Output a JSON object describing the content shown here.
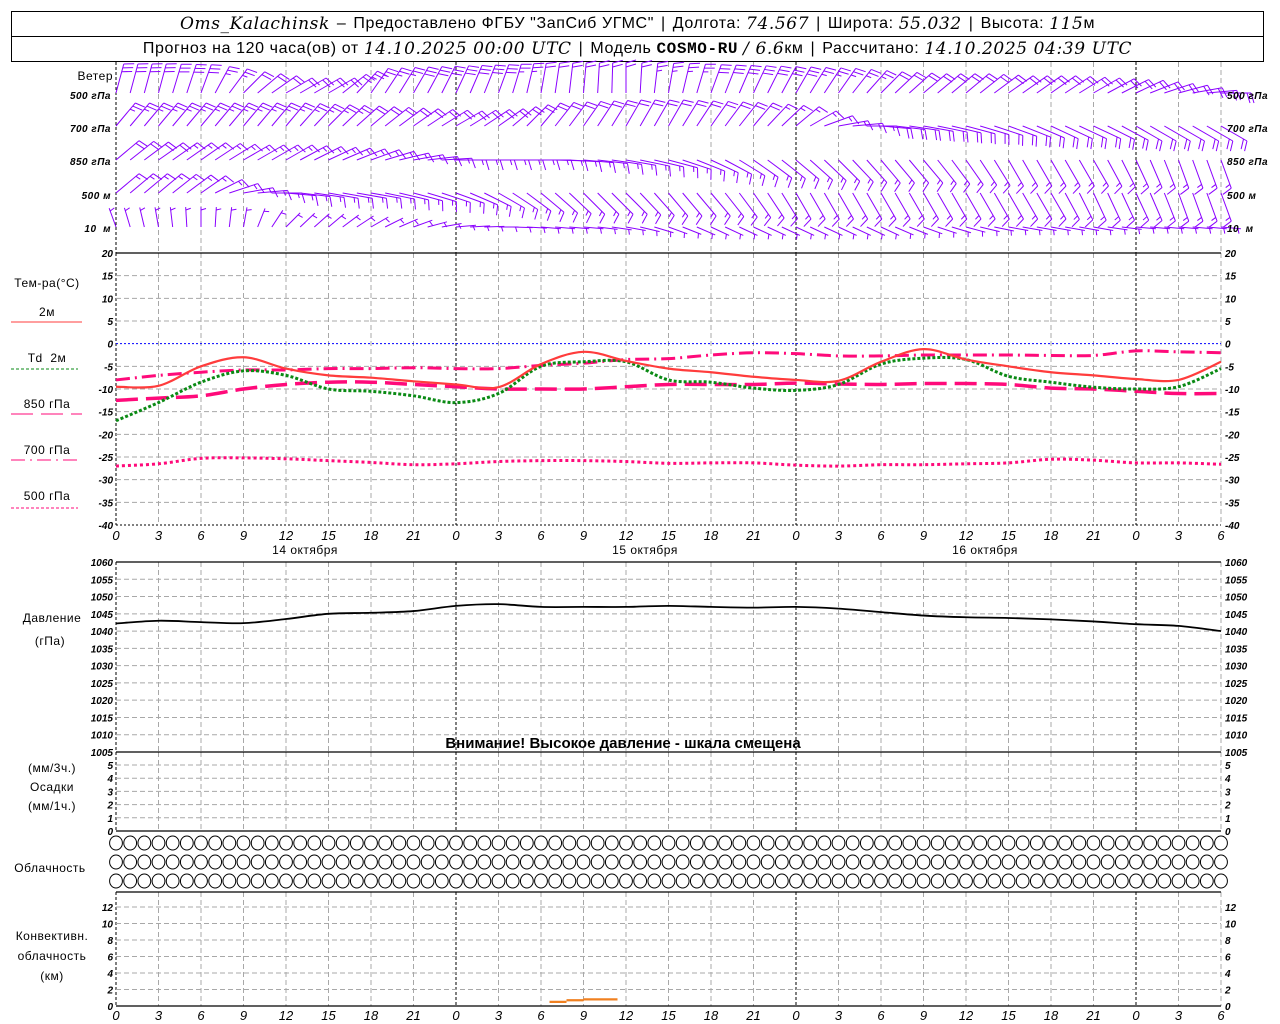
{
  "header": {
    "station": "Oms_Kalachinsk",
    "dash": "–",
    "provider": "Предоставлено ФГБУ \"ЗапСиб УГМС\"",
    "lon_label": "Долгота:",
    "lon": "74.567",
    "lat_label": "Широта:",
    "lat": "55.032",
    "alt_label": "Высота:",
    "alt": "115",
    "alt_unit": "м",
    "forecast_label": "Прогноз на 120 часа(ов) от",
    "forecast_start": "14.10.2025 00:00 UTC",
    "model_label": "Модель",
    "model": "COSMO-RU",
    "resolution": "/ 6.6",
    "resolution_unit": "км",
    "computed_label": "Рассчитано:",
    "computed": "14.10.2025 04:39 UTC"
  },
  "labels": {
    "wind": "Ветер",
    "wind_levels": [
      "500 гПа",
      "700 гПа",
      "850 гПа",
      "500 м",
      "10  м"
    ],
    "temp_title": "Тем-ра(°C)",
    "legend_2m": "2м",
    "legend_td": "Td  2м",
    "legend_850": "850 гПа",
    "legend_700": "700 гПа",
    "legend_500": "500 гПа",
    "pressure_1": "Давление",
    "pressure_2": "(гПа)",
    "precip_1": "(мм/3ч.)",
    "precip_2": "Осадки",
    "precip_3": "(мм/1ч.)",
    "cloud": "Облачность",
    "conv_1": "Конвективн.",
    "conv_2": "облачность",
    "conv_3": "(км)",
    "warning": "Внимание! Высокое давление - шкала смещена",
    "days": [
      "14 октября",
      "15 октября",
      "16 октября"
    ]
  },
  "colors": {
    "t2m": "#ff3c3c",
    "td2m": "#0a8a14",
    "t850": "#ff0a7a",
    "t700": "#ff0a7a",
    "t500": "#ff0a7a",
    "wind": "#8a00ff",
    "pressure": "#000000",
    "conv": "#f08020",
    "zero_line": "#0000ff",
    "grid": "#a8a8a8"
  },
  "chart_data": {
    "type": "line",
    "x_step_hours": 3,
    "x": [
      0,
      3,
      6,
      9,
      12,
      15,
      18,
      21,
      0,
      3,
      6,
      9,
      12,
      15,
      18,
      21,
      0,
      3,
      6,
      9,
      12,
      15,
      18,
      21,
      0,
      3,
      6
    ],
    "temperature": {
      "ylabel": "Тем-ра(°C)",
      "ylim": [
        -40,
        20
      ],
      "yticks": [
        20,
        15,
        10,
        5,
        0,
        -5,
        -10,
        -15,
        -20,
        -25,
        -30,
        -35,
        -40
      ],
      "grid": true,
      "series": [
        {
          "name": "2м",
          "key": "t2m",
          "values": [
            -9.5,
            -9.3,
            -5,
            -3,
            -5.5,
            -7,
            -7.5,
            -8.3,
            -9,
            -9.6,
            -4.5,
            -1.8,
            -3.8,
            -5.5,
            -6.3,
            -7.3,
            -8,
            -8.2,
            -4,
            -1.2,
            -3.5,
            -5,
            -6.3,
            -7,
            -7.8,
            -8,
            -4
          ]
        },
        {
          "name": "Td  2м",
          "key": "td2m",
          "values": [
            -17,
            -13,
            -8.5,
            -6,
            -7,
            -10,
            -10.5,
            -11.5,
            -13,
            -11,
            -5,
            -4,
            -4,
            -8,
            -8.5,
            -9.8,
            -10.3,
            -9,
            -4.5,
            -3.2,
            -3.5,
            -7.2,
            -8.5,
            -9.6,
            -10,
            -9.5,
            -5.5
          ]
        },
        {
          "name": "850 гПа",
          "key": "t850",
          "values": [
            -12.5,
            -12,
            -11.5,
            -10,
            -9,
            -8.5,
            -8.5,
            -9,
            -9.5,
            -10,
            -10,
            -10,
            -9.5,
            -9,
            -9,
            -9,
            -8.7,
            -8.9,
            -9,
            -8.8,
            -8.8,
            -9,
            -9.8,
            -10,
            -10.5,
            -11,
            -11
          ]
        },
        {
          "name": "700 гПа",
          "key": "t700",
          "values": [
            -8,
            -7,
            -6.3,
            -5.8,
            -5.8,
            -5.5,
            -5.5,
            -5.3,
            -5.5,
            -5.5,
            -4.8,
            -4.3,
            -3.5,
            -3.3,
            -2.5,
            -2,
            -2.2,
            -2.7,
            -2.7,
            -2.5,
            -2.5,
            -2.5,
            -2.6,
            -2.6,
            -1.6,
            -1.8,
            -2
          ]
        },
        {
          "name": "500 гПа",
          "key": "t500",
          "values": [
            -27,
            -26.5,
            -25.3,
            -25.2,
            -25.4,
            -25.8,
            -26.2,
            -26.7,
            -26.5,
            -26,
            -25.8,
            -25.8,
            -26,
            -26.4,
            -26.3,
            -26.3,
            -26.8,
            -27,
            -26.7,
            -26.7,
            -26.5,
            -26.3,
            -25.5,
            -25.7,
            -26.3,
            -26.3,
            -26.6
          ]
        }
      ]
    },
    "pressure": {
      "ylabel": "Давление (гПа)",
      "ylim": [
        1005,
        1060
      ],
      "yticks": [
        1060,
        1055,
        1050,
        1045,
        1040,
        1035,
        1030,
        1025,
        1020,
        1015,
        1010,
        1005
      ],
      "values": [
        1042.2,
        1043,
        1042.6,
        1042.3,
        1043.5,
        1045,
        1045.3,
        1045.8,
        1047.3,
        1047.8,
        1047,
        1047,
        1047,
        1047.3,
        1047,
        1046.8,
        1047,
        1046.5,
        1045.5,
        1044.5,
        1044,
        1043.8,
        1043.4,
        1042.8,
        1042,
        1041.5,
        1040
      ]
    },
    "precipitation": {
      "ylim": [
        0,
        5
      ],
      "yticks": [
        5,
        4,
        3,
        2,
        1,
        0
      ],
      "values": [
        0,
        0,
        0,
        0,
        0,
        0,
        0,
        0,
        0,
        0,
        0,
        0,
        0,
        0,
        0,
        0,
        0,
        0,
        0,
        0,
        0,
        0,
        0,
        0,
        0,
        0,
        0
      ]
    },
    "cloudiness": {
      "rows": 3,
      "hourly_count": 79,
      "cover": "clear"
    },
    "convective_cloud": {
      "ylabel": "Конвективн. облачность (км)",
      "ylim": [
        0,
        14
      ],
      "yticks": [
        12,
        10,
        8,
        6,
        4,
        2,
        0
      ],
      "segments": [
        {
          "from_hour": 30.6,
          "to_hour": 31.8,
          "top_km": 0.5
        },
        {
          "from_hour": 31.8,
          "to_hour": 33.0,
          "top_km": 0.7
        },
        {
          "from_hour": 33.0,
          "to_hour": 35.4,
          "top_km": 0.8
        }
      ]
    },
    "wind": {
      "units": "m/s",
      "levels": [
        {
          "name": "500 гПа",
          "dir": [
            15,
            15,
            20,
            45,
            60,
            60,
            35,
            30,
            25,
            20,
            10,
            5,
            0,
            10,
            20,
            25,
            30,
            35,
            45,
            50,
            50,
            55,
            55,
            60,
            65,
            75,
            90
          ],
          "speed": [
            17,
            16,
            15,
            12,
            10,
            10,
            14,
            15,
            15,
            15,
            12,
            11,
            10,
            14,
            15,
            15,
            15,
            14,
            12,
            12,
            12,
            12,
            11,
            11,
            10,
            10,
            10
          ]
        },
        {
          "name": "700 гПа",
          "dir": [
            40,
            40,
            40,
            40,
            40,
            45,
            50,
            55,
            60,
            55,
            40,
            35,
            30,
            30,
            35,
            40,
            50,
            80,
            95,
            100,
            105,
            110,
            115,
            115,
            120,
            120,
            120
          ],
          "speed": [
            14,
            14,
            14,
            14,
            14,
            13,
            12,
            11,
            10,
            10,
            10,
            11,
            11,
            11,
            11,
            10,
            9,
            9,
            10,
            11,
            11,
            11,
            11,
            11,
            10,
            10,
            10
          ]
        },
        {
          "name": "850 гПа",
          "dir": [
            50,
            55,
            55,
            60,
            60,
            65,
            70,
            80,
            90,
            90,
            90,
            95,
            100,
            105,
            115,
            125,
            130,
            135,
            140,
            140,
            145,
            150,
            150,
            150,
            155,
            160,
            160
          ],
          "speed": [
            10,
            10,
            9,
            9,
            9,
            9,
            8,
            8,
            8,
            8,
            8,
            8,
            8,
            8,
            9,
            9,
            9,
            9,
            9,
            9,
            9,
            9,
            9,
            9,
            9,
            9,
            9
          ]
        },
        {
          "name": "500 м",
          "dir": [
            50,
            50,
            55,
            80,
            95,
            100,
            100,
            105,
            110,
            120,
            130,
            135,
            135,
            140,
            140,
            145,
            150,
            150,
            150,
            150,
            150,
            150,
            150,
            155,
            155,
            160,
            160
          ],
          "speed": [
            9,
            9,
            9,
            8,
            8,
            8,
            8,
            8,
            8,
            8,
            8,
            8,
            8,
            8,
            8,
            9,
            9,
            9,
            9,
            9,
            9,
            9,
            9,
            8,
            8,
            8,
            8
          ]
        },
        {
          "name": "10  м",
          "dir": [
            340,
            350,
            0,
            10,
            45,
            50,
            60,
            70,
            85,
            90,
            95,
            95,
            100,
            110,
            115,
            115,
            115,
            115,
            115,
            110,
            105,
            100,
            100,
            100,
            95,
            95,
            95
          ],
          "speed": [
            3,
            3,
            3,
            3,
            4,
            4,
            4,
            4,
            4,
            4,
            4,
            4,
            4,
            4,
            4,
            4,
            4,
            4,
            4,
            4,
            4,
            4,
            4,
            4,
            4,
            4,
            4
          ]
        }
      ]
    }
  }
}
